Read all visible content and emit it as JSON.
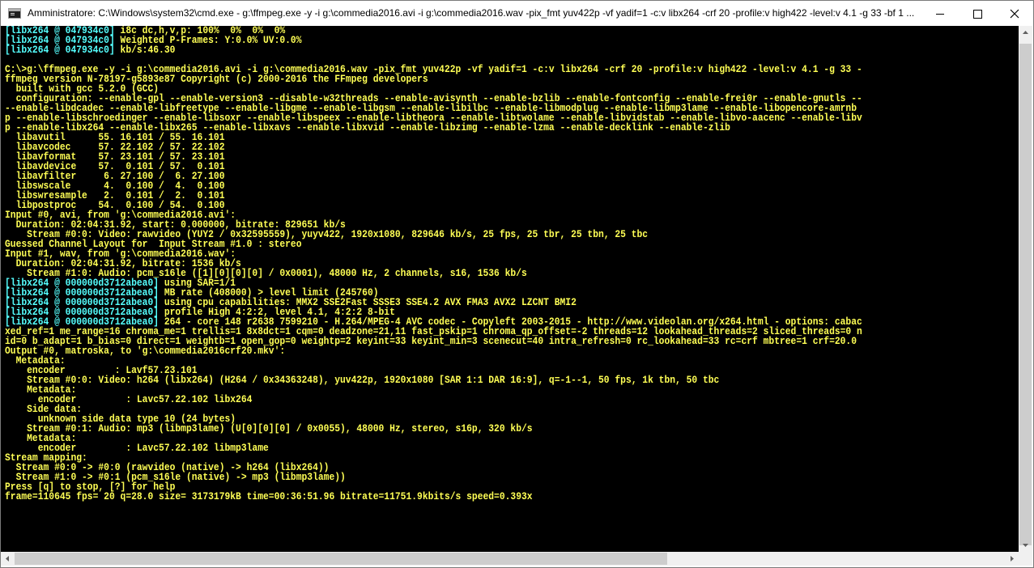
{
  "window": {
    "title": "Amministratore: C:\\Windows\\system32\\cmd.exe - g:\\ffmpeg.exe  -y -i g:\\commedia2016.avi -i g:\\commedia2016.wav -pix_fmt yuv422p -vf yadif=1 -c:v libx264 -crf 20 -profile:v high422 -level:v 4.1 -g 33 -bf 1 ...",
    "icon": "cmd-icon",
    "controls": {
      "minimize": "minimize-icon",
      "maximize": "maximize-icon",
      "close": "close-icon"
    }
  },
  "colors": {
    "console_bg": "#000000",
    "console_text": "#c0c0c0",
    "highlight_text": "#ffff55",
    "tag_text": "#55ffff"
  },
  "console": {
    "lines": [
      "[libx264 @ 047934c0] i8c dc,h,v,p: 100%  0%  0%  0%",
      "[libx264 @ 047934c0] Weighted P-Frames: Y:0.0% UV:0.0%",
      "[libx264 @ 047934c0] kb/s:46.30",
      "",
      "C:\\>g:\\ffmpeg.exe -y -i g:\\commedia2016.avi -i g:\\commedia2016.wav -pix_fmt yuv422p -vf yadif=1 -c:v libx264 -crf 20 -profile:v high422 -level:v 4.1 -g 33 -",
      "ffmpeg version N-78197-g5893e87 Copyright (c) 2000-2016 the FFmpeg developers",
      "  built with gcc 5.2.0 (GCC)",
      "  configuration: --enable-gpl --enable-version3 --disable-w32threads --enable-avisynth --enable-bzlib --enable-fontconfig --enable-frei0r --enable-gnutls --",
      "--enable-libdcadec --enable-libfreetype --enable-libgme --enable-libgsm --enable-libilbc --enable-libmodplug --enable-libmp3lame --enable-libopencore-amrnb",
      "p --enable-libschroedinger --enable-libsoxr --enable-libspeex --enable-libtheora --enable-libtwolame --enable-libvidstab --enable-libvo-aacenc --enable-libv",
      "p --enable-libx264 --enable-libx265 --enable-libxavs --enable-libxvid --enable-libzimg --enable-lzma --enable-decklink --enable-zlib",
      "  libavutil      55. 16.101 / 55. 16.101",
      "  libavcodec     57. 22.102 / 57. 22.102",
      "  libavformat    57. 23.101 / 57. 23.101",
      "  libavdevice    57.  0.101 / 57.  0.101",
      "  libavfilter     6. 27.100 /  6. 27.100",
      "  libswscale      4.  0.100 /  4.  0.100",
      "  libswresample   2.  0.101 /  2.  0.101",
      "  libpostproc    54.  0.100 / 54.  0.100",
      "Input #0, avi, from 'g:\\commedia2016.avi':",
      "  Duration: 02:04:31.92, start: 0.000000, bitrate: 829651 kb/s",
      "    Stream #0:0: Video: rawvideo (YUY2 / 0x32595559), yuyv422, 1920x1080, 829646 kb/s, 25 fps, 25 tbr, 25 tbn, 25 tbc",
      "Guessed Channel Layout for  Input Stream #1.0 : stereo",
      "Input #1, wav, from 'g:\\commedia2016.wav':",
      "  Duration: 02:04:31.92, bitrate: 1536 kb/s",
      "    Stream #1:0: Audio: pcm_s16le ([1][0][0][0] / 0x0001), 48000 Hz, 2 channels, s16, 1536 kb/s",
      "[libx264 @ 000000d3712abea0] using SAR=1/1",
      "[libx264 @ 000000d3712abea0] MB rate (408000) > level limit (245760)",
      "[libx264 @ 000000d3712abea0] using cpu capabilities: MMX2 SSE2Fast SSSE3 SSE4.2 AVX FMA3 AVX2 LZCNT BMI2",
      "[libx264 @ 000000d3712abea0] profile High 4:2:2, level 4.1, 4:2:2 8-bit",
      "[libx264 @ 000000d3712abea0] 264 - core 148 r2638 7599210 - H.264/MPEG-4 AVC codec - Copyleft 2003-2015 - http://www.videolan.org/x264.html - options: cabac",
      "xed_ref=1 me_range=16 chroma_me=1 trellis=1 8x8dct=1 cqm=0 deadzone=21,11 fast_pskip=1 chroma_qp_offset=-2 threads=12 lookahead_threads=2 sliced_threads=0 n",
      "id=0 b_adapt=1 b_bias=0 direct=1 weightb=1 open_gop=0 weightp=2 keyint=33 keyint_min=3 scenecut=40 intra_refresh=0 rc_lookahead=33 rc=crf mbtree=1 crf=20.0",
      "Output #0, matroska, to 'g:\\commedia2016crf20.mkv':",
      "  Metadata:",
      "    encoder         : Lavf57.23.101",
      "    Stream #0:0: Video: h264 (libx264) (H264 / 0x34363248), yuv422p, 1920x1080 [SAR 1:1 DAR 16:9], q=-1--1, 50 fps, 1k tbn, 50 tbc",
      "    Metadata:",
      "      encoder         : Lavc57.22.102 libx264",
      "    Side data:",
      "      unknown side data type 10 (24 bytes)",
      "    Stream #0:1: Audio: mp3 (libmp3lame) (U[0][0][0] / 0x0055), 48000 Hz, stereo, s16p, 320 kb/s",
      "    Metadata:",
      "      encoder         : Lavc57.22.102 libmp3lame",
      "Stream mapping:",
      "  Stream #0:0 -> #0:0 (rawvideo (native) -> h264 (libx264))",
      "  Stream #1:0 -> #0:1 (pcm_s16le (native) -> mp3 (libmp3lame))",
      "Press [q] to stop, [?] for help",
      "frame=110645 fps= 20 q=28.0 size= 3173179kB time=00:36:51.96 bitrate=11751.9kbits/s speed=0.393x"
    ]
  }
}
